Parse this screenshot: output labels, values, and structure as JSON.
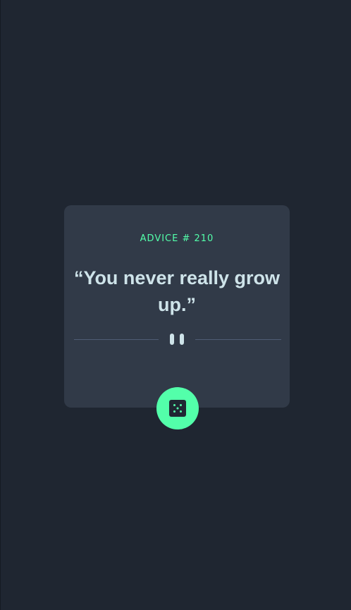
{
  "card": {
    "advice_id": "ADVICE # 210",
    "advice_text": "“You never really grow up.”"
  },
  "divider": {
    "icon": "pause-icon"
  },
  "dice_button": {
    "icon": "dice-icon"
  },
  "colors": {
    "background": "#1f2631",
    "card": "#313a48",
    "accent": "#53ffaa",
    "text": "#cee3e9",
    "divider": "#4f5d74"
  }
}
